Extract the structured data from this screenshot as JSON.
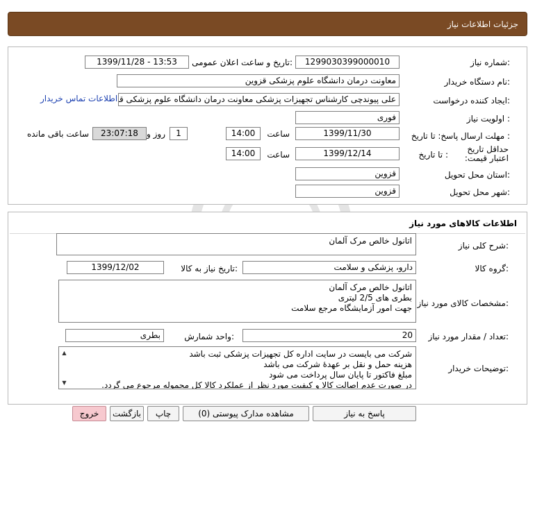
{
  "header": {
    "title": "جزئیات اطلاعات نیاز"
  },
  "section1": {
    "need_number_label": "شماره نیاز:",
    "need_number": "1299030399000010",
    "announce_label": "تاریخ و ساعت اعلان عمومی:",
    "announce_value": "1399/11/28 - 13:53",
    "buyer_org_label": "نام دستگاه خریدار:",
    "buyer_org": "معاونت درمان دانشگاه علوم پزشکی قزوین",
    "requester_label": "ایجاد کننده درخواست:",
    "requester": "علی پیوندچی کارشناس تجهیزات پزشکی معاونت درمان دانشگاه علوم پزشکی قزوین",
    "contact_link": "اطلاعات تماس خریدار",
    "priority_label": "اولویت نیاز :",
    "priority": "فوری",
    "deadline_label": "مهلت ارسال پاسخ: تا تاریخ :",
    "deadline_date": "1399/11/30",
    "time_label": "ساعت",
    "deadline_time": "14:00",
    "days_value": "1",
    "days_label": "روز و",
    "remaining_time": "23:07:18",
    "remaining_label": "ساعت باقی مانده",
    "validity_label": "حداقل تاریخ اعتبار قیمت:",
    "validity_date_label": "تا تاریخ :",
    "validity_date": "1399/12/14",
    "validity_time_label": "ساعت",
    "validity_time": "14:00",
    "province_label": "استان محل تحویل:",
    "province": "قزوین",
    "city_label": "شهر محل تحویل:",
    "city": "قزوین"
  },
  "section2": {
    "title": "اطلاعات کالاهای مورد نیاز",
    "general_desc_label": "شرح کلی نیاز:",
    "general_desc": "اتانول خالص مرک آلمان",
    "group_label": "گروه کالا:",
    "group": "دارو، پزشکی و سلامت",
    "need_date_label": "تاریخ نیاز به کالا:",
    "need_date": "1399/12/02",
    "specs_label": "مشخصات کالای مورد نیاز:",
    "specs": [
      "اتانول خالص مرک آلمان",
      "بطری های 2/5 لیتری",
      "جهت امور آزمایشگاه مرجع سلامت"
    ],
    "qty_label": "تعداد / مقدار مورد نیاز:",
    "qty": "20",
    "unit_label": "واحد شمارش:",
    "unit": "بطری",
    "notes_label": "توضیحات خریدار:",
    "notes": [
      "شرکت می بایست در سایت اداره کل تجهیزات پزشکی ثبت باشد",
      "هزینه حمل و نقل بر عهدۀ شرکت می باشد",
      "مبلغ فاکتور تا پایان سال پرداخت می شود",
      "در صورت عدم  اصالت کالا و کیفیت مورد نظر از عملکرد کالا کل محموله مرجوع می گردد."
    ]
  },
  "buttons": {
    "reply": "پاسخ به نیاز",
    "attachments": "مشاهده مدارک پیوستی (0)",
    "print": "چاپ",
    "back": "بازگشت",
    "exit": "خروج"
  },
  "colors": {
    "header_bg": "#7a4a24",
    "exit_bg": "#f7c9cf",
    "link": "#1a3fb0",
    "remaining_bg": "#d9d9d9"
  }
}
